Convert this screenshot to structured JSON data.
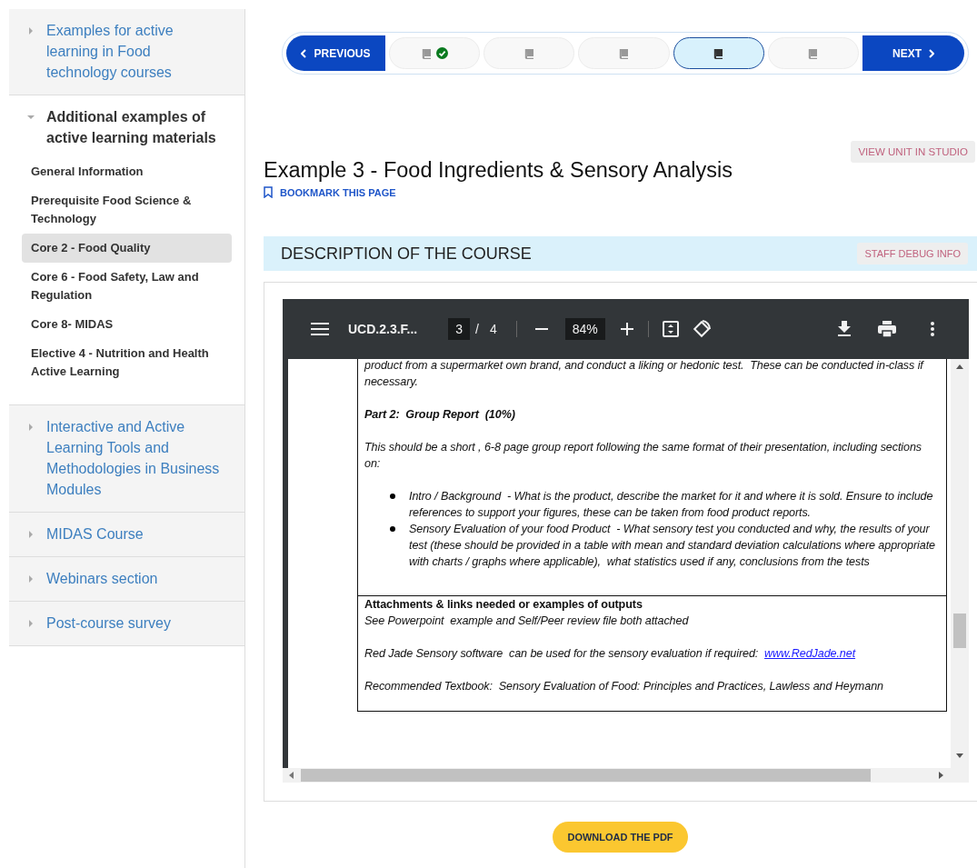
{
  "sidebar": {
    "sections": [
      {
        "title": "Examples for active learning in Food technology courses",
        "expanded": false
      },
      {
        "title": "Additional examples of active learning materials",
        "expanded": true,
        "children": [
          {
            "label": "General Information",
            "selected": false
          },
          {
            "label": "Prerequisite Food Science & Technology",
            "selected": false
          },
          {
            "label": "Core 2 - Food Quality",
            "selected": true
          },
          {
            "label": "Core 6 - Food Safety, Law and Regulation",
            "selected": false
          },
          {
            "label": "Core 8- MIDAS",
            "selected": false
          },
          {
            "label": "Elective 4 - Nutrition and Health Active Learning",
            "selected": false
          }
        ]
      },
      {
        "title": "Interactive and Active Learning Tools and Methodologies in Business Modules",
        "expanded": false
      },
      {
        "title": "MIDAS Course",
        "expanded": false
      },
      {
        "title": "Webinars section",
        "expanded": false
      },
      {
        "title": "Post-course survey",
        "expanded": false
      }
    ]
  },
  "sequence_nav": {
    "previous": "PREVIOUS",
    "next": "NEXT",
    "units": [
      {
        "completed": true,
        "selected": false
      },
      {
        "completed": false,
        "selected": false
      },
      {
        "completed": false,
        "selected": false
      },
      {
        "completed": false,
        "selected": true
      },
      {
        "completed": false,
        "selected": false
      }
    ]
  },
  "studio_button": "VIEW UNIT IN STUDIO",
  "page_title": "Example 3 - Food Ingredients & Sensory Analysis",
  "bookmark": "BOOKMARK THIS PAGE",
  "section": {
    "title": "DESCRIPTION OF THE COURSE",
    "debug_button": "STAFF DEBUG INFO"
  },
  "pdf_viewer": {
    "file_name": "UCD.2.3.F...",
    "page": "3",
    "page_separator": "/",
    "page_count": "4",
    "zoom": "84%",
    "cells": [
      {
        "blocks": [
          {
            "kind": "text",
            "text": "product from a supermarket own brand, and conduct a liking or hedonic test.  These can be conducted in-class if necessary."
          },
          {
            "kind": "heading",
            "text": "Part 2:  Group Report  (10%)"
          },
          {
            "kind": "text",
            "text": "This should be a short , 6-8 page group report following the same format of their presentation, including sections on:"
          },
          {
            "kind": "bullets",
            "items": [
              "Intro / Background  - What is the product, describe the market for it and where it is sold. Ensure to include references to support your figures, these can be taken from food product reports.",
              "Sensory Evaluation of your food Product  - What sensory test you conducted and why, the results of your test (these should be provided in a table with mean and standard deviation calculations where appropriate with charts / graphs where applicable),  what statistics used if any, conclusions from the tests"
            ]
          }
        ]
      },
      {
        "blocks": [
          {
            "kind": "label",
            "text": "Attachments & links needed or examples of outputs"
          },
          {
            "kind": "text",
            "text": "See Powerpoint  example and Self/Peer review file both attached"
          },
          {
            "kind": "link_text",
            "text": "Red Jade Sensory software  can be used for the sensory evaluation if required:  ",
            "link": "www.RedJade.net"
          },
          {
            "kind": "text",
            "text": "Recommended Textbook:  Sensory Evaluation of Food: Principles and Practices, Lawless and Heymann"
          }
        ]
      }
    ]
  },
  "download_button": "DOWNLOAD THE PDF"
}
